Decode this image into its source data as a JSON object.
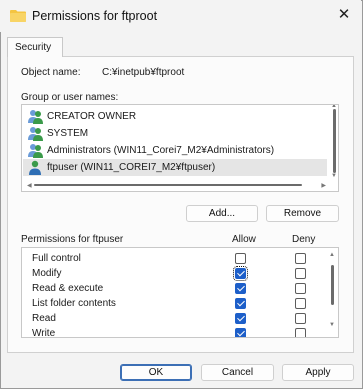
{
  "window": {
    "title": "Permissions for ftproot",
    "close_glyph": "✕"
  },
  "tabs": [
    {
      "label": "Security"
    }
  ],
  "object": {
    "label": "Object name:",
    "value": "C:¥inetpub¥ftproot"
  },
  "group_list": {
    "label": "Group or user names:",
    "items": [
      {
        "name": "CREATOR OWNER",
        "icon": "users-group-icon"
      },
      {
        "name": "SYSTEM",
        "icon": "users-group-icon"
      },
      {
        "name": "Administrators (WIN11_Corei7_M2¥Administrators)",
        "icon": "users-group-icon"
      },
      {
        "name": "ftpuser (WIN11_COREI7_M2¥ftpuser)",
        "icon": "single-user-icon",
        "selected": true
      }
    ]
  },
  "buttons": {
    "add": "Add...",
    "remove": "Remove",
    "ok": "OK",
    "cancel": "Cancel",
    "apply": "Apply"
  },
  "permissions": {
    "label": "Permissions for ftpuser",
    "allow_header": "Allow",
    "deny_header": "Deny",
    "items": [
      {
        "name": "Full control",
        "allow": false,
        "deny": false
      },
      {
        "name": "Modify",
        "allow": true,
        "deny": false,
        "focused": true
      },
      {
        "name": "Read & execute",
        "allow": true,
        "deny": false
      },
      {
        "name": "List folder contents",
        "allow": true,
        "deny": false
      },
      {
        "name": "Read",
        "allow": true,
        "deny": false
      },
      {
        "name": "Write",
        "allow": true,
        "deny": false
      }
    ]
  },
  "colors": {
    "accent": "#1d5fc9",
    "folder": "#f4c542",
    "user_green": "#3a9a4a"
  }
}
